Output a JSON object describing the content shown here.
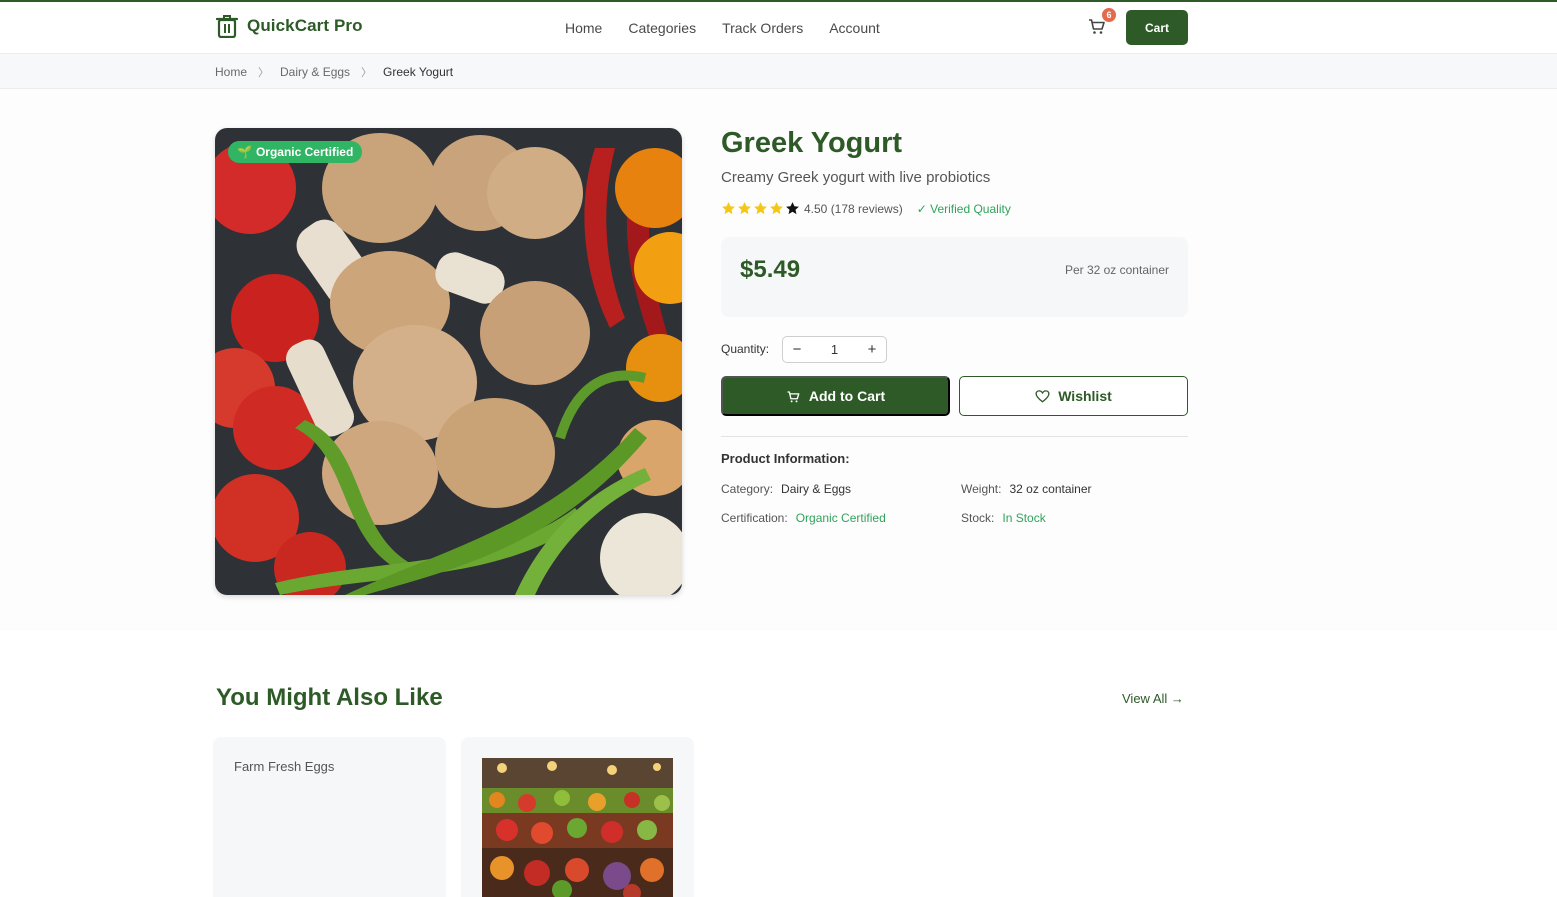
{
  "header": {
    "logo_text": "QuickCart Pro",
    "nav": [
      "Home",
      "Categories",
      "Track Orders",
      "Account"
    ],
    "cart_count": "6",
    "cart_button": "Cart"
  },
  "breadcrumb": {
    "items": [
      "Home",
      "Dairy & Eggs"
    ],
    "current": "Greek Yogurt"
  },
  "product": {
    "badge": "Organic Certified",
    "title": "Greek Yogurt",
    "subtitle": "Creamy Greek yogurt with live probiotics",
    "rating_value": 4.5,
    "rating_text": "4.50 (178 reviews)",
    "verified": "✓ Verified Quality",
    "price": "$5.49",
    "per_unit": "Per 32 oz container",
    "quantity_label": "Quantity:",
    "quantity": "1",
    "add_to_cart": "Add to Cart",
    "wishlist": "Wishlist",
    "info_title": "Product Information:",
    "info": {
      "category_label": "Category:",
      "category": "Dairy & Eggs",
      "weight_label": "Weight:",
      "weight": "32 oz container",
      "certification_label": "Certification:",
      "certification": "Organic Certified",
      "stock_label": "Stock:",
      "stock": "In Stock"
    }
  },
  "related": {
    "title": "You Might Also Like",
    "view_all": "View All →",
    "cards": [
      {
        "alt": "Farm Fresh Eggs"
      }
    ]
  },
  "colors": {
    "brand": "#2d5a27",
    "accent_green": "#2fa35a",
    "badge_red": "#e36a4d",
    "star_gold": "#f5c518"
  }
}
